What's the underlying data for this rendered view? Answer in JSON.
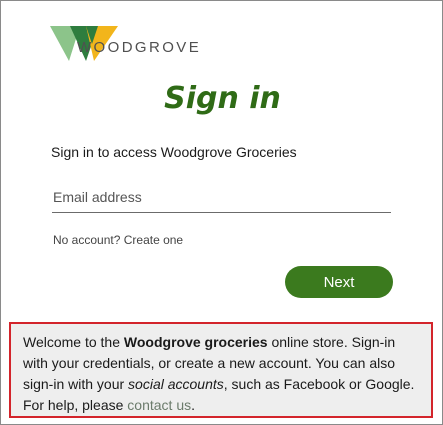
{
  "brand": {
    "name": "WOODGROVE",
    "colors": {
      "light_green": "#8cc48a",
      "dark_green": "#2e7d3e",
      "yellow": "#f2b51b"
    }
  },
  "page": {
    "title": "Sign in",
    "subtitle": "Sign in to access Woodgrove Groceries"
  },
  "form": {
    "email_placeholder": "Email address",
    "email_value": "",
    "no_account_text": "No account?",
    "create_link": "Create one",
    "next_label": "Next"
  },
  "welcome": {
    "part1": "Welcome to the ",
    "bold": "Woodgrove groceries",
    "part2": " online store. Sign-in with your credentials, or create a new account. You can also sign-in with your ",
    "italic": "social accounts",
    "part3": ", such as Facebook or Google. For help, please ",
    "link": "contact us",
    "part4": "."
  },
  "colors": {
    "title": "#2f6b16",
    "button": "#3b7a1e",
    "highlight_border": "#d3242b",
    "panel_bg": "#eeeeee"
  }
}
